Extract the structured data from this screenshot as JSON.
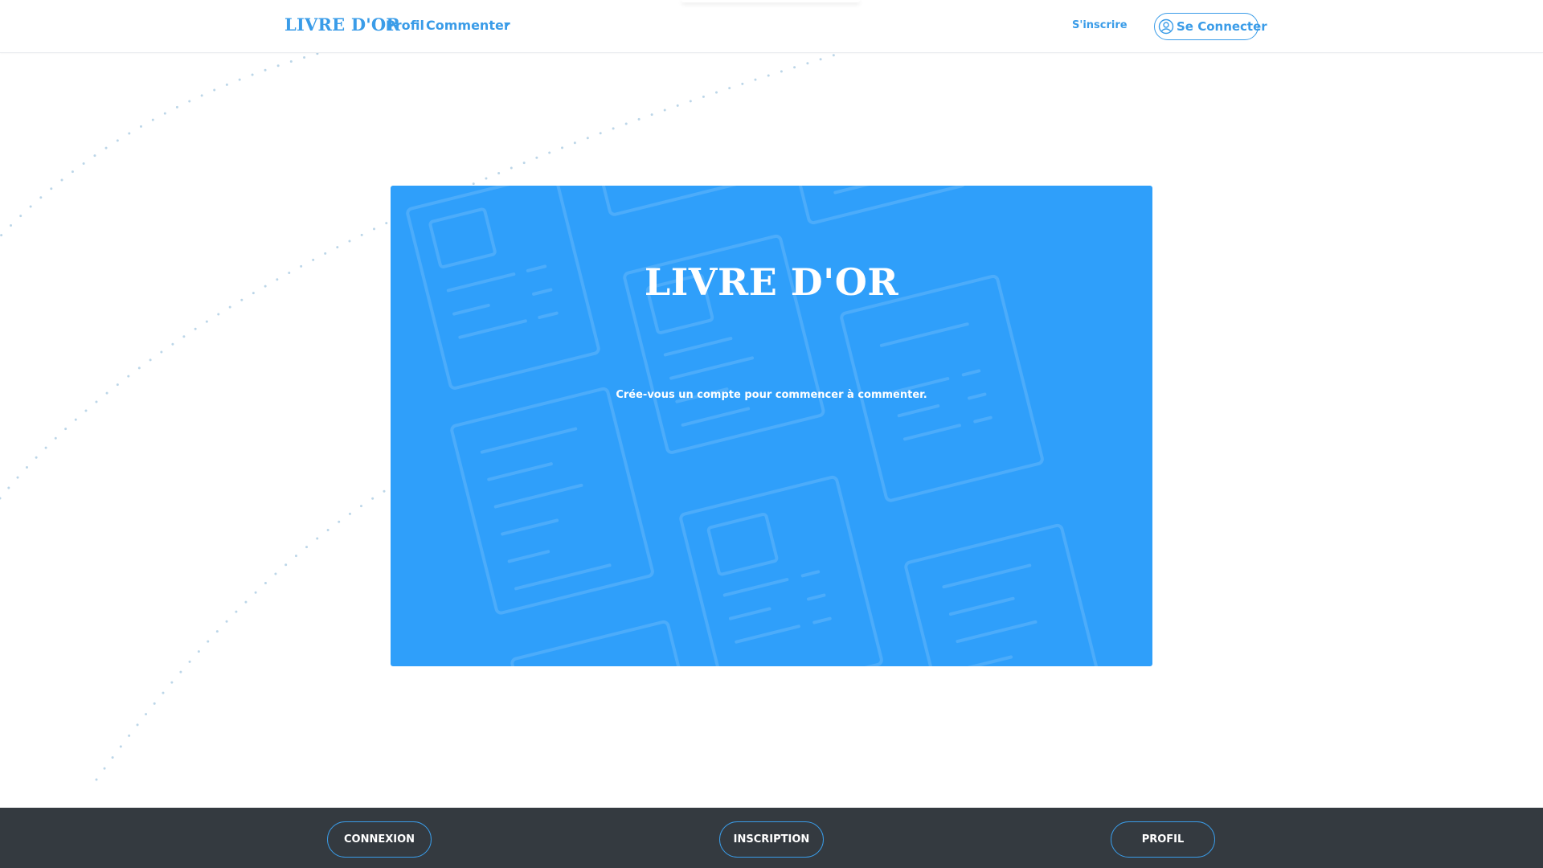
{
  "colors": {
    "accent": "#3a9ce8",
    "hero_background": "#2f9ffa",
    "footer_background": "#343a40",
    "background": "#ffffff"
  },
  "navbar": {
    "brand": "LIVRE D'OR",
    "links": {
      "profil": "Profil",
      "commenter": "Commenter"
    },
    "signup": "S'inscrire",
    "login": {
      "label": "Se Connecter",
      "icon": "user-circle-icon"
    },
    "dropdown_icon": "caret-down-icon"
  },
  "hero": {
    "title": "LIVRE D'OR",
    "subtitle": "Crée-vous un compte pour commencer à commenter."
  },
  "footer": {
    "buttons": {
      "connexion": "CONNEXION",
      "inscription": "INSCRIPTION",
      "profil": "PROFIL"
    }
  }
}
